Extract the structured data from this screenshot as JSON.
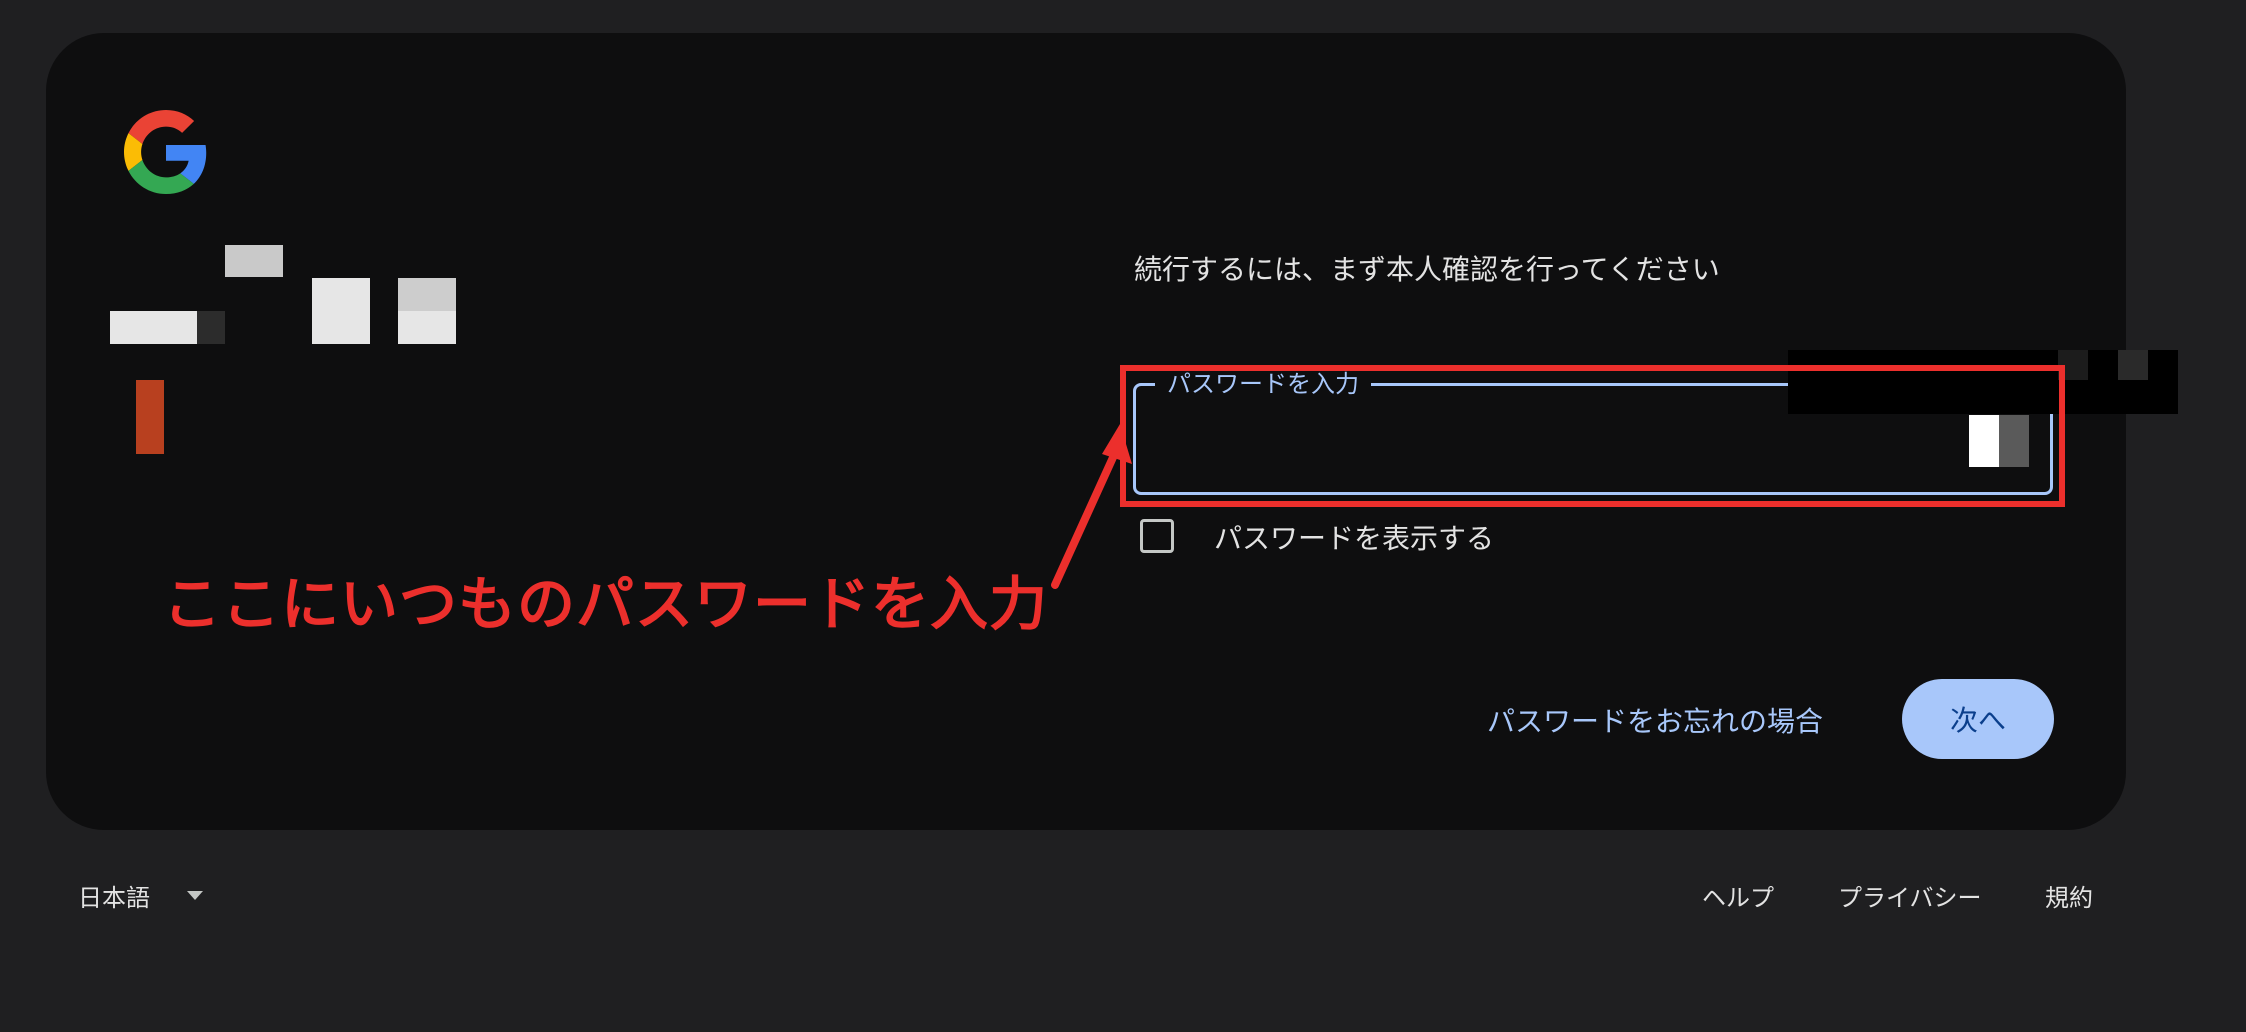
{
  "card": {
    "subtitle": "続行するには、まず本人確認を行ってください"
  },
  "password_field": {
    "label": "パスワードを入力",
    "value": ""
  },
  "show_password": {
    "label": "パスワードを表示する",
    "checked": false
  },
  "annotation": {
    "text": "ここにいつものパスワードを入力",
    "color": "#ec2f2c"
  },
  "actions": {
    "forgot_password": "パスワードをお忘れの場合",
    "next": "次へ"
  },
  "footer": {
    "language": "日本語",
    "help": "ヘルプ",
    "privacy": "プライバシー",
    "terms": "規約"
  },
  "colors": {
    "accent": "#a8c7fa",
    "button_text": "#0b3f8c",
    "highlight": "#ec2f2c",
    "card": "#0e0e0f",
    "page": "#1f1f21"
  },
  "icons": {
    "logo": "google-g-logo",
    "language_caret": "caret-down-icon"
  }
}
